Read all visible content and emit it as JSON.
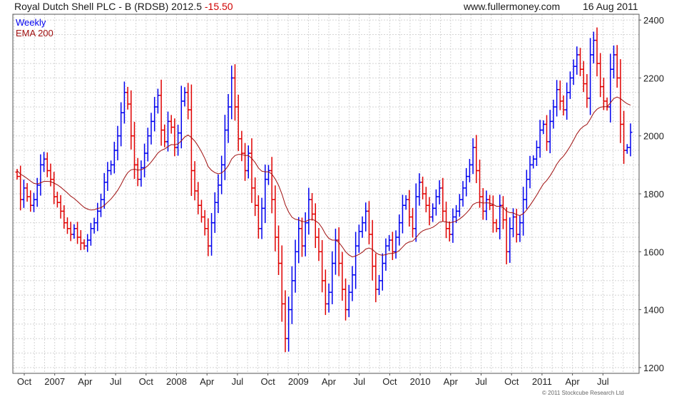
{
  "header": {
    "title": "Royal Dutch Shell PLC - B (RDSB) 2012.5",
    "change": "-15.50",
    "site": "www.fullermoney.com",
    "date": "16 Aug 2011"
  },
  "copyright": "© 2011 Stockcube Research Ltd",
  "colors": {
    "up": "#0000ee",
    "down": "#e00000",
    "ema": "#a01010",
    "grid": "#d4d4d4",
    "frame": "#555555"
  },
  "chart_data": {
    "type": "bar",
    "series": [
      {
        "name": "Weekly",
        "values": [
          1860,
          1780,
          1820,
          1790,
          1760,
          1780,
          1830,
          1900,
          1920,
          1880,
          1850,
          1790,
          1770,
          1740,
          1700,
          1680,
          1660,
          1680,
          1650,
          1630,
          1620,
          1640,
          1680,
          1700,
          1740,
          1780,
          1840,
          1880,
          1900,
          1950,
          2000,
          2080,
          2150,
          2110,
          2000,
          1900,
          1850,
          1890,
          1940,
          2000,
          2050,
          2100,
          2140,
          2020,
          1980,
          2050,
          2030,
          1960,
          2010,
          2120,
          2150,
          2090,
          1880,
          1810,
          1760,
          1720,
          1680,
          1620,
          1700,
          1770,
          1830,
          1900,
          2020,
          2100,
          2200,
          2100,
          1990,
          1940,
          1880,
          1940,
          1820,
          1760,
          1680,
          1750,
          1850,
          1880,
          1780,
          1650,
          1560,
          1420,
          1300,
          1400,
          1500,
          1600,
          1680,
          1620,
          1700,
          1780,
          1730,
          1650,
          1600,
          1500,
          1420,
          1460,
          1560,
          1640,
          1560,
          1470,
          1400,
          1460,
          1520,
          1620,
          1670,
          1700,
          1740,
          1660,
          1550,
          1470,
          1500,
          1560,
          1620,
          1640,
          1600,
          1650,
          1700,
          1760,
          1780,
          1720,
          1680,
          1790,
          1840,
          1800,
          1760,
          1720,
          1750,
          1790,
          1820,
          1740,
          1680,
          1660,
          1720,
          1740,
          1780,
          1820,
          1860,
          1900,
          1960,
          1880,
          1790,
          1740,
          1780,
          1760,
          1700,
          1680,
          1760,
          1710,
          1600,
          1680,
          1720,
          1660,
          1700,
          1780,
          1850,
          1900,
          1920,
          1960,
          2020,
          2040,
          1980,
          2050,
          2100,
          2160,
          2120,
          2090,
          2150,
          2200,
          2240,
          2280,
          2230,
          2180,
          2130,
          2280,
          2330,
          2250,
          2170,
          2120,
          2100,
          2230,
          2280,
          2200,
          2040,
          1950,
          1960,
          2012.5
        ]
      },
      {
        "name": "EMA 200",
        "values": [
          1880,
          1868,
          1861,
          1853,
          1844,
          1836,
          1834,
          1838,
          1843,
          1843,
          1842,
          1837,
          1831,
          1823,
          1813,
          1803,
          1792,
          1784,
          1774,
          1763,
          1753,
          1747,
          1744,
          1745,
          1749,
          1752,
          1760,
          1771,
          1782,
          1796,
          1812,
          1832,
          1855,
          1873,
          1883,
          1885,
          1882,
          1883,
          1888,
          1897,
          1910,
          1925,
          1941,
          1950,
          1955,
          1963,
          1970,
          1969,
          1972,
          1983,
          1996,
          2003,
          1994,
          1982,
          1965,
          1945,
          1922,
          1894,
          1881,
          1873,
          1869,
          1872,
          1882,
          1897,
          1920,
          1932,
          1936,
          1936,
          1932,
          1932,
          1922,
          1908,
          1889,
          1878,
          1876,
          1876,
          1868,
          1851,
          1829,
          1799,
          1762,
          1737,
          1719,
          1712,
          1710,
          1704,
          1704,
          1710,
          1712,
          1707,
          1698,
          1682,
          1661,
          1646,
          1640,
          1640,
          1632,
          1617,
          1600,
          1589,
          1582,
          1585,
          1591,
          1598,
          1609,
          1613,
          1608,
          1597,
          1590,
          1588,
          1590,
          1594,
          1594,
          1597,
          1604,
          1616,
          1628,
          1634,
          1637,
          1648,
          1663,
          1672,
          1677,
          1680,
          1684,
          1692,
          1702,
          1705,
          1703,
          1700,
          1702,
          1706,
          1713,
          1722,
          1733,
          1746,
          1763,
          1769,
          1771,
          1768,
          1769,
          1768,
          1763,
          1757,
          1757,
          1753,
          1740,
          1735,
          1734,
          1728,
          1725,
          1731,
          1744,
          1760,
          1777,
          1795,
          1815,
          1834,
          1846,
          1862,
          1881,
          1902,
          1918,
          1930,
          1946,
          1964,
          1985,
          2007,
          2023,
          2033,
          2040,
          2058,
          2079,
          2092,
          2099,
          2101,
          2101,
          2114,
          2129,
          2134,
          2129,
          2119,
          2111,
          2106
        ]
      }
    ],
    "x_tick_labels": [
      "Oct",
      "2007",
      "Apr",
      "Jul",
      "Oct",
      "2008",
      "Apr",
      "Jul",
      "Oct",
      "2009",
      "Apr",
      "Jul",
      "Oct",
      "2010",
      "Apr",
      "Jul",
      "Oct",
      "2011",
      "Apr",
      "Jul"
    ],
    "y_ticks": [
      1200,
      1400,
      1600,
      1800,
      2000,
      2200,
      2400
    ],
    "ylim": [
      1180,
      2420
    ],
    "legend_position": "top-left",
    "grid": true,
    "style": "weekly OHLC bars, blue = up week, red = down week"
  }
}
